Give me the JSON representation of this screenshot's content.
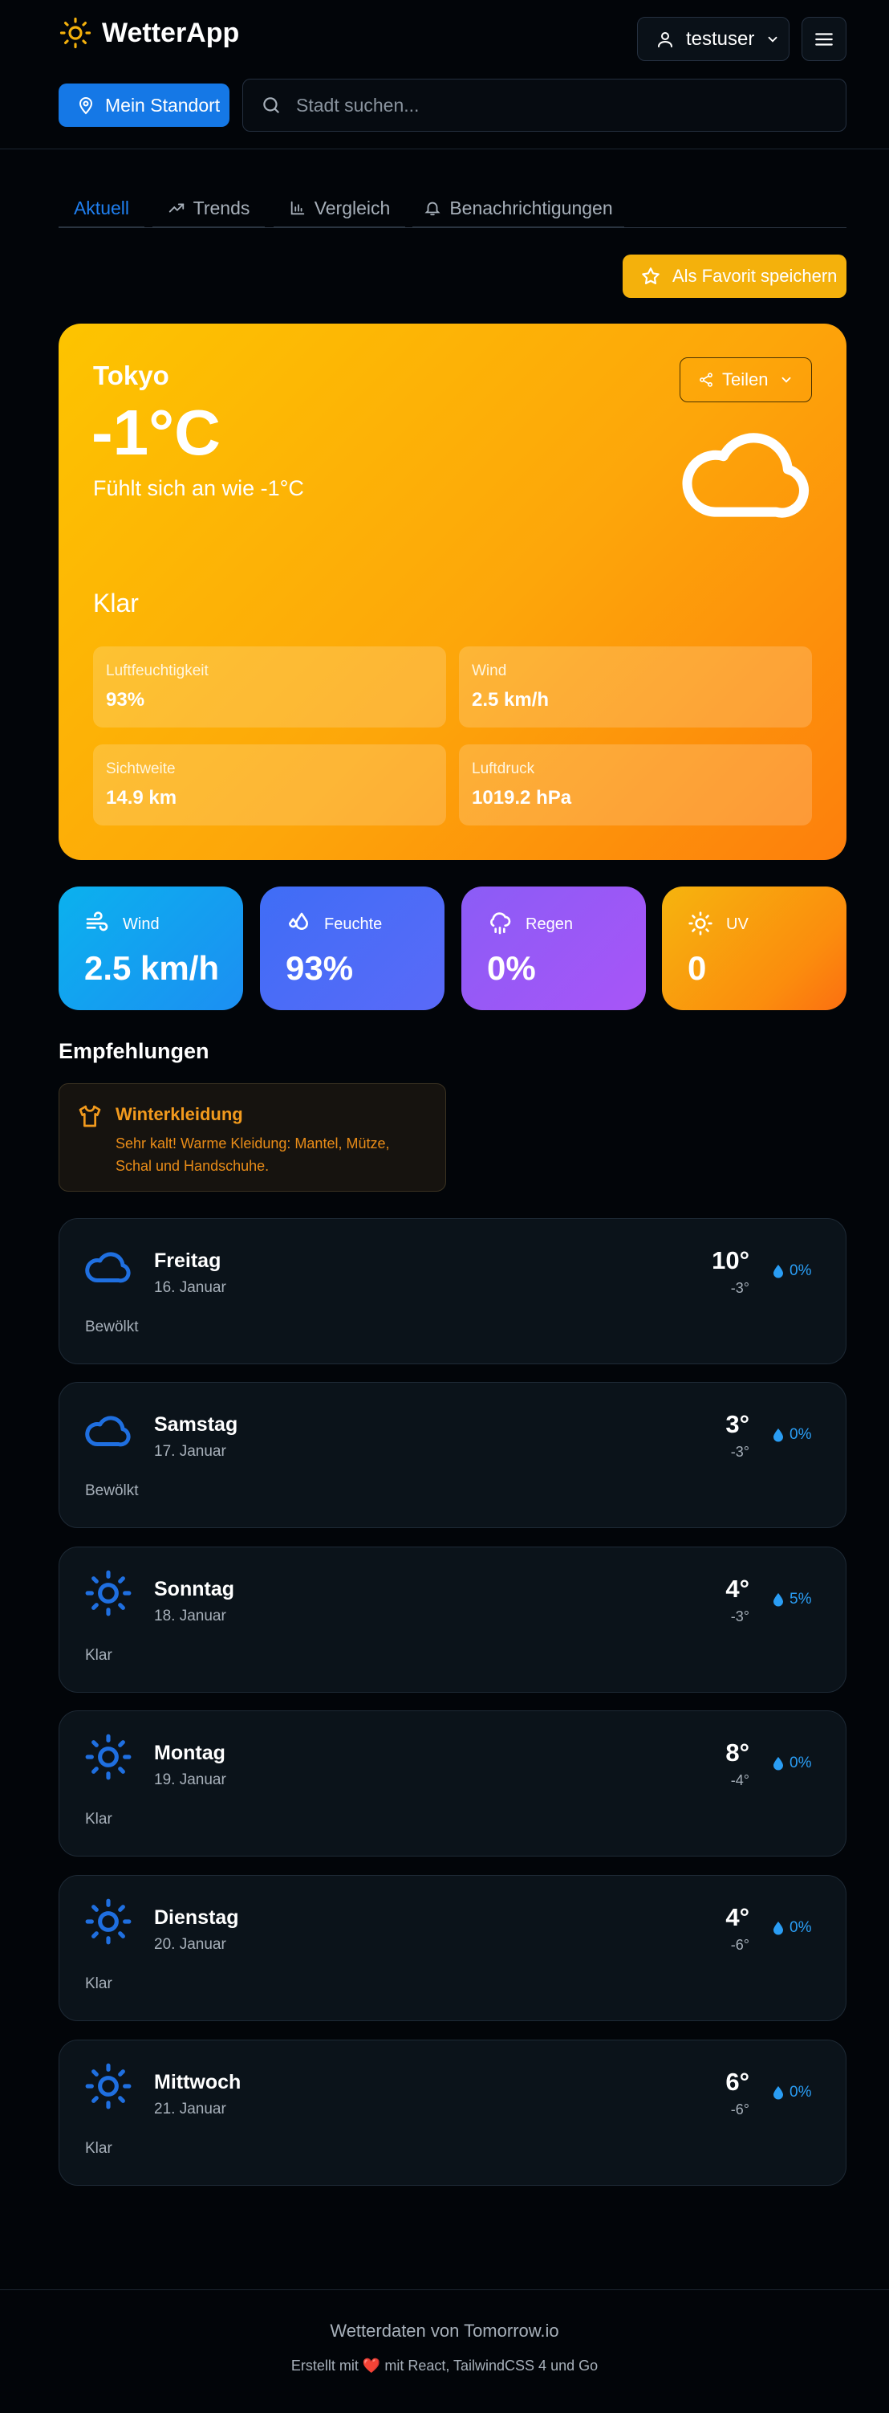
{
  "app": {
    "title": "WetterApp"
  },
  "user": {
    "name": "testuser"
  },
  "location_button": "Mein Standort",
  "search": {
    "placeholder": "Stadt suchen..."
  },
  "tabs": [
    {
      "label": "Aktuell"
    },
    {
      "label": "Trends"
    },
    {
      "label": "Vergleich"
    },
    {
      "label": "Benachrichtigungen"
    }
  ],
  "favorite_button": "Als Favorit speichern",
  "current": {
    "city": "Tokyo",
    "temperature": "-1°C",
    "feels_like": "Fühlt sich an wie -1°C",
    "share_label": "Teilen",
    "condition": "Klar",
    "stats": [
      {
        "label": "Luftfeuchtigkeit",
        "value": "93%"
      },
      {
        "label": "Wind",
        "value": "2.5 km/h"
      },
      {
        "label": "Sichtweite",
        "value": "14.9 km"
      },
      {
        "label": "Luftdruck",
        "value": "1019.2 hPa"
      }
    ]
  },
  "tiles": [
    {
      "label": "Wind",
      "value": "2.5 km/h",
      "icon": "wind-icon"
    },
    {
      "label": "Feuchte",
      "value": "93%",
      "icon": "droplets-icon"
    },
    {
      "label": "Regen",
      "value": "0%",
      "icon": "cloud-rain-icon"
    },
    {
      "label": "UV",
      "value": "0",
      "icon": "sun-icon"
    }
  ],
  "recommendations": {
    "title": "Empfehlungen",
    "items": [
      {
        "title": "Winterkleidung",
        "text": "Sehr kalt! Warme Kleidung: Mantel, Mütze, Schal und Handschuhe.",
        "icon": "shirt-icon"
      }
    ]
  },
  "forecast": [
    {
      "day": "Freitag",
      "date": "16. Januar",
      "high": "10°",
      "low": "-3°",
      "rain": "0%",
      "condition": "Bewölkt",
      "icon": "cloud-icon"
    },
    {
      "day": "Samstag",
      "date": "17. Januar",
      "high": "3°",
      "low": "-3°",
      "rain": "0%",
      "condition": "Bewölkt",
      "icon": "cloud-icon"
    },
    {
      "day": "Sonntag",
      "date": "18. Januar",
      "high": "4°",
      "low": "-3°",
      "rain": "5%",
      "condition": "Klar",
      "icon": "sun-icon"
    },
    {
      "day": "Montag",
      "date": "19. Januar",
      "high": "8°",
      "low": "-4°",
      "rain": "0%",
      "condition": "Klar",
      "icon": "sun-icon"
    },
    {
      "day": "Dienstag",
      "date": "20. Januar",
      "high": "4°",
      "low": "-6°",
      "rain": "0%",
      "condition": "Klar",
      "icon": "sun-icon"
    },
    {
      "day": "Mittwoch",
      "date": "21. Januar",
      "high": "6°",
      "low": "-6°",
      "rain": "0%",
      "condition": "Klar",
      "icon": "sun-icon"
    }
  ],
  "footer": {
    "source": "Wetterdaten von Tomorrow.io",
    "credit_prefix": "Erstellt mit",
    "credit_suffix": "mit React, TailwindCSS 4 und Go"
  },
  "colors": {
    "accent": "#1578e6",
    "favorite": "#f4b10c",
    "hero_start": "#fdc400",
    "hero_end": "#fd7f0c",
    "forecast_icon": "#1f6fe0",
    "rain": "#2a9df4"
  }
}
